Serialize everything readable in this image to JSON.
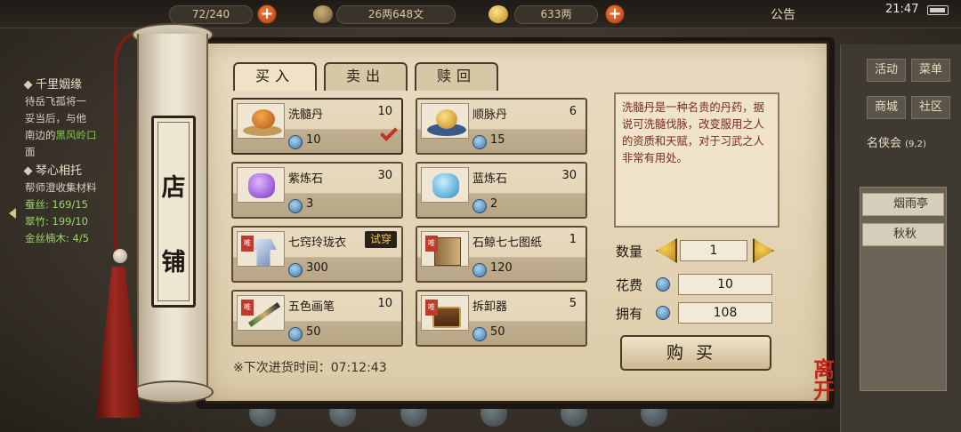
{
  "topbar": {
    "stamina": "72/240",
    "copper": "26两648文",
    "gold": "633两",
    "announcement": "公告",
    "time": "21:47"
  },
  "quest_panel": {
    "quests": [
      {
        "title": "千里姻缘",
        "lines": [
          "待岳飞孤将一",
          "妥当后，与他",
          "南边的",
          "面"
        ],
        "highlight": "黑风岭口"
      },
      {
        "title": "琴心相托",
        "lines": [
          "帮师澄收集材料"
        ],
        "items": [
          {
            "name": "蚕丝:",
            "count": "169/15"
          },
          {
            "name": "翠竹:",
            "count": "199/10"
          },
          {
            "name": "金丝楠木:",
            "count": "4/5"
          }
        ]
      }
    ]
  },
  "side_menu": {
    "buttons": [
      "活动",
      "菜单",
      "商城",
      "社区"
    ],
    "guild": "名侠会",
    "guild_count": "(9,2)",
    "people": [
      "烟雨亭",
      "秋秋"
    ]
  },
  "shop": {
    "title_chars": [
      "店",
      "铺"
    ],
    "tabs": [
      "买入",
      "卖出",
      "赎回"
    ],
    "active_tab": "买入",
    "items": [
      {
        "name": "洗髓丹",
        "qty": "10",
        "price": "10",
        "art": "orange-pill",
        "selected": true,
        "hot": false
      },
      {
        "name": "顺脉丹",
        "qty": "6",
        "price": "15",
        "art": "gold-pill",
        "selected": false,
        "hot": false
      },
      {
        "name": "紫炼石",
        "qty": "30",
        "price": "3",
        "art": "purple-stone",
        "selected": false,
        "hot": false
      },
      {
        "name": "蓝炼石",
        "qty": "30",
        "price": "2",
        "art": "blue-stone",
        "selected": false,
        "hot": false
      },
      {
        "name": "七窍玲珑衣",
        "qty": "",
        "price": "300",
        "art": "robe",
        "selected": false,
        "hot": true,
        "badge": "试穿"
      },
      {
        "name": "石鲸七七图纸",
        "qty": "1",
        "price": "120",
        "art": "book",
        "selected": false,
        "hot": true
      },
      {
        "name": "五色画笔",
        "qty": "10",
        "price": "50",
        "art": "brush",
        "selected": false,
        "hot": true
      },
      {
        "name": "拆卸器",
        "qty": "5",
        "price": "50",
        "art": "chest",
        "selected": false,
        "hot": true
      }
    ],
    "hot_tag": "唯",
    "restock_label": "※下次进货时间：07:12:43",
    "description": "洗髓丹是一种名贵的丹药，据说可洗髓伐脉，改变服用之人的资质和天赋，对于习武之人非常有用处。",
    "quantity_label": "数量",
    "quantity": "1",
    "cost_label": "花费",
    "cost": "10",
    "owned_label": "拥有",
    "owned": "108",
    "buy_label": "购买",
    "leave_label": "离开"
  },
  "colors": {
    "accent_red": "#c2341f",
    "parchment": "#e9dcc1",
    "ink": "#1f170f",
    "hint_text": "#7a2a1c"
  }
}
